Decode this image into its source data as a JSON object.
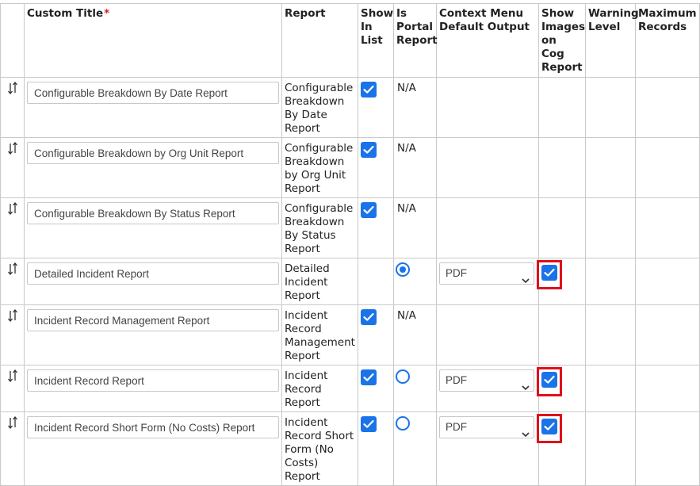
{
  "headers": {
    "custom_title": "Custom Title",
    "required_mark": "*",
    "report": "Report",
    "show_in_list": "Show In List",
    "is_portal_report": "Is Portal Report",
    "context_menu_default_output": "Context Menu Default Output",
    "show_images_on_cog_report": "Show Images on Cog Report",
    "warning_level": "Warning Level",
    "maximum_records": "Maximum Records"
  },
  "rows": [
    {
      "title": "Configurable Breakdown By Date Report",
      "report": "Configurable Breakdown By Date Report",
      "show_in_list": true,
      "portal_text": "N/A",
      "output": "",
      "show_images": false
    },
    {
      "title": "Configurable Breakdown by Org Unit Report",
      "report": "Configurable Breakdown by Org Unit Report",
      "show_in_list": true,
      "portal_text": "N/A",
      "output": "",
      "show_images": false
    },
    {
      "title": "Configurable Breakdown By Status Report",
      "report": "Configurable Breakdown By Status Report",
      "show_in_list": true,
      "portal_text": "N/A",
      "output": "",
      "show_images": false
    },
    {
      "title": "Detailed Incident Report",
      "report": "Detailed Incident Report",
      "show_in_list": false,
      "portal_radio": "selected",
      "output": "PDF",
      "show_images": true
    },
    {
      "title": "Incident Record Management Report",
      "report": "Incident Record Management Report",
      "show_in_list": true,
      "portal_text": "N/A",
      "output": "",
      "show_images": false
    },
    {
      "title": "Incident Record Report",
      "report": "Incident Record Report",
      "show_in_list": true,
      "portal_radio": "unselected",
      "output": "PDF",
      "show_images": true
    },
    {
      "title": "Incident Record Short Form (No Costs) Report",
      "report": "Incident Record Short Form (No Costs) Report",
      "show_in_list": true,
      "portal_radio": "unselected",
      "output": "PDF",
      "show_images": true
    }
  ],
  "colors": {
    "accent": "#1a73e8",
    "highlight": "#e0101c",
    "required": "#d62020",
    "border": "#c9c9c9"
  }
}
